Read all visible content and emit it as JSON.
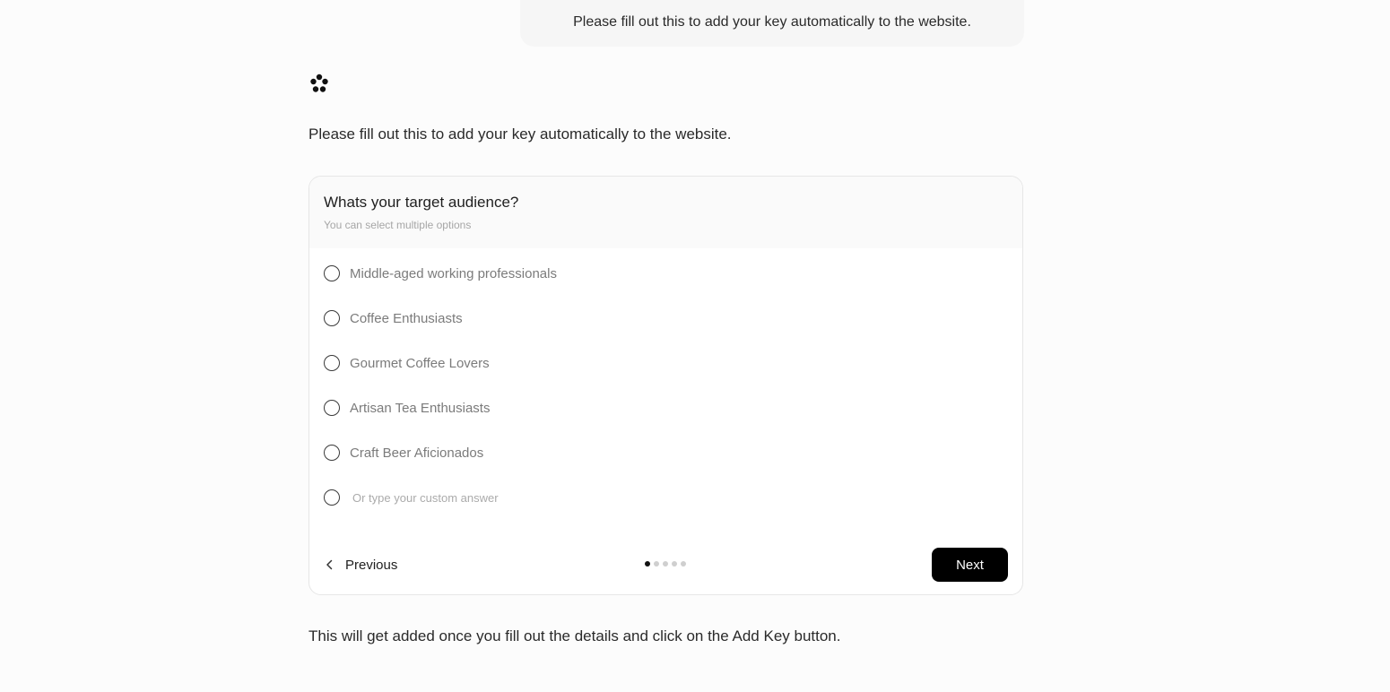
{
  "user_message": "Please fill out this to add your key automatically to the website.",
  "assistant": {
    "logo_icon": "flower-logo-icon",
    "message": "Please fill out this to add your key automatically to the website.",
    "footer_note": "This will get added once you fill out the details and click on the Add Key button."
  },
  "form": {
    "question": "Whats your target audience?",
    "hint": "You can select multiple options",
    "options": [
      "Middle-aged working professionals",
      "Coffee Enthusiasts",
      "Gourmet Coffee Lovers",
      "Artisan Tea Enthusiasts",
      "Craft Beer Aficionados"
    ],
    "custom_placeholder": "Or type your custom answer",
    "previous_label": "Previous",
    "next_label": "Next",
    "current_step": 1,
    "total_steps": 5
  },
  "colors": {
    "accent": "#000000",
    "background": "#fcfcfc",
    "card_header": "#fafafa"
  }
}
